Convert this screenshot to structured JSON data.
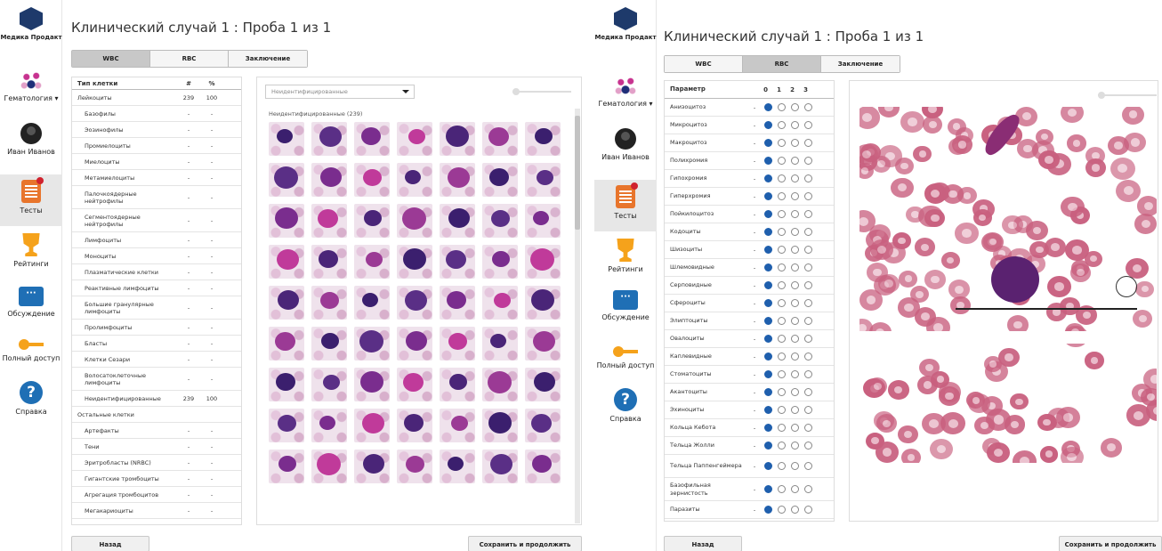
{
  "app": {
    "brand": "Медика Продакт",
    "nav": {
      "hematology": "Гематология ▾",
      "user": "Иван Иванов",
      "tests": "Тесты",
      "ratings": "Рейтинги",
      "discussion": "Обсуждение",
      "full_access": "Полный доступ",
      "help": "Справка"
    },
    "title": "Клинический случай 1 : Проба 1 из 1",
    "tabs": [
      "WBC",
      "RBC",
      "Заключение"
    ],
    "back_label": "Назад",
    "save_label": "Сохранить и продолжить"
  },
  "wbc": {
    "header": {
      "cell_type": "Тип клетки",
      "count": "#",
      "percent": "%"
    },
    "rows": [
      {
        "name": "Лейкоциты",
        "count": "239",
        "pct": "100",
        "group": true
      },
      {
        "name": "Базофилы",
        "count": "-",
        "pct": "-"
      },
      {
        "name": "Эозинофилы",
        "count": "-",
        "pct": "-"
      },
      {
        "name": "Промиелоциты",
        "count": "-",
        "pct": "-"
      },
      {
        "name": "Миелоциты",
        "count": "-",
        "pct": "-"
      },
      {
        "name": "Метамиелоциты",
        "count": "-",
        "pct": "-"
      },
      {
        "name": "Палочкоядерные нейтрофилы",
        "count": "-",
        "pct": "-"
      },
      {
        "name": "Сегментоядерные нейтрофилы",
        "count": "-",
        "pct": "-"
      },
      {
        "name": "Лимфоциты",
        "count": "-",
        "pct": "-"
      },
      {
        "name": "Моноциты",
        "count": "-",
        "pct": "-"
      },
      {
        "name": "Плазматические клетки",
        "count": "-",
        "pct": "-"
      },
      {
        "name": "Реактивные лимфоциты",
        "count": "-",
        "pct": "-"
      },
      {
        "name": "Большие гранулярные лимфоциты",
        "count": "-",
        "pct": "-"
      },
      {
        "name": "Пролимфоциты",
        "count": "-",
        "pct": "-"
      },
      {
        "name": "Бласты",
        "count": "-",
        "pct": "-"
      },
      {
        "name": "Клетки Сезари",
        "count": "-",
        "pct": "-"
      },
      {
        "name": "Волосатоклеточные лимфоциты",
        "count": "-",
        "pct": "-"
      },
      {
        "name": "Неидентифицированные",
        "count": "239",
        "pct": "100"
      },
      {
        "name": "Остальные клетки",
        "count": "",
        "pct": "",
        "group": true
      },
      {
        "name": "Артефакты",
        "count": "-",
        "pct": "-"
      },
      {
        "name": "Тени",
        "count": "-",
        "pct": "-"
      },
      {
        "name": "Эритробласты (NRBC)",
        "count": "-",
        "pct": "-"
      },
      {
        "name": "Гигантские тромбоциты",
        "count": "-",
        "pct": "-"
      },
      {
        "name": "Агрегация тромбоцитов",
        "count": "-",
        "pct": "-"
      },
      {
        "name": "Мегакариоциты",
        "count": "-",
        "pct": "-"
      }
    ],
    "filter_value": "Неидентифицированные",
    "grid_label": "Неидентифицированные (239)"
  },
  "rbc": {
    "header": {
      "param": "Параметр",
      "levels": [
        "0",
        "1",
        "2",
        "3"
      ]
    },
    "rows": [
      {
        "name": "Анизоцитоз",
        "value": "-",
        "selected": 0
      },
      {
        "name": "Микроцитоз",
        "value": "-",
        "selected": 0
      },
      {
        "name": "Макроцитоз",
        "value": "-",
        "selected": 0
      },
      {
        "name": "Полихромия",
        "value": "-",
        "selected": 0
      },
      {
        "name": "Гипохромия",
        "value": "-",
        "selected": 0
      },
      {
        "name": "Гиперхромия",
        "value": "-",
        "selected": 0
      },
      {
        "name": "Пойкилоцитоз",
        "value": "-",
        "selected": 0
      },
      {
        "name": "Кодоциты",
        "value": "-",
        "selected": 0
      },
      {
        "name": "Шизоциты",
        "value": "-",
        "selected": 0
      },
      {
        "name": "Шлемовидные",
        "value": "-",
        "selected": 0
      },
      {
        "name": "Серповидные",
        "value": "-",
        "selected": 0
      },
      {
        "name": "Сфероциты",
        "value": "-",
        "selected": 0
      },
      {
        "name": "Элиптоциты",
        "value": "-",
        "selected": 0
      },
      {
        "name": "Овалоциты",
        "value": "-",
        "selected": 0
      },
      {
        "name": "Каплевидные",
        "value": "-",
        "selected": 0
      },
      {
        "name": "Стоматоциты",
        "value": "-",
        "selected": 0
      },
      {
        "name": "Акантоциты",
        "value": "-",
        "selected": 0
      },
      {
        "name": "Эхиноциты",
        "value": "-",
        "selected": 0
      },
      {
        "name": "Кольца Кебота",
        "value": "-",
        "selected": 0
      },
      {
        "name": "Тельца Жолли",
        "value": "-",
        "selected": 0
      },
      {
        "name": "Тельца Паппенгеймера",
        "value": "-",
        "selected": 0
      },
      {
        "name": "Базофильная зернистость",
        "value": "-",
        "selected": 0
      },
      {
        "name": "Паразиты",
        "value": "-",
        "selected": 0
      }
    ]
  },
  "icons": {
    "logo": "cube-logo-icon",
    "hematology": "blood-cells-icon",
    "user": "user-avatar-icon",
    "tests": "clipboard-icon",
    "ratings": "trophy-icon",
    "discussion": "chat-icon",
    "full_access": "key-icon",
    "help": "question-icon"
  },
  "colors": {
    "accent": "#1f5fad",
    "active_tab": "#c8c8c8",
    "sidebar_active": "#e7e7e7"
  }
}
